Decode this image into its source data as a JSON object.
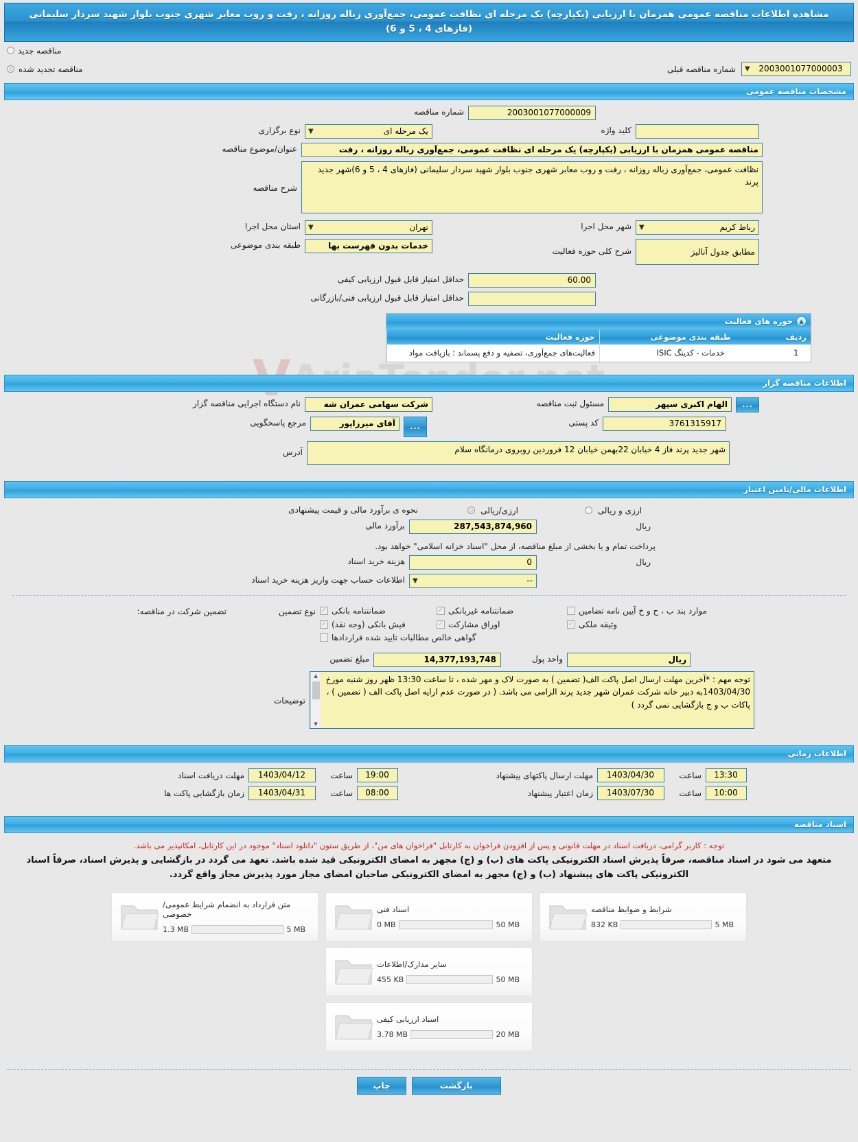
{
  "page": {
    "title": "مشاهده اطلاعات مناقصه عمومی همزمان با ارزیابی (یکپارچه) یک مرحله ای نظافت عمومی، جمع‌آوری زباله روزانه ، رفت و روب معابر شهری جنوب بلوار شهید سردار سلیمانی (فازهای 4 ، 5 و 6)"
  },
  "tender_type": {
    "new_label": "مناقصه جدید",
    "renewed_label": "مناقصه تجدید شده",
    "selected": "renewed",
    "previous_number_label": "شماره مناقصه قبلی",
    "previous_number_value": "2003001077000003"
  },
  "general": {
    "section_title": "مشخصات مناقصه عمومی",
    "tender_number_label": "شماره مناقصه",
    "tender_number_value": "2003001077000009",
    "holding_type_label": "نوع برگزاری",
    "holding_type_value": "یک مرحله ای",
    "keyword_label": "کلید واژه",
    "keyword_value": "",
    "subject_label": "عنوان/موضوع مناقصه",
    "subject_value": "مناقصه عمومی همزمان با ارزیابی (یکپارچه) یک مرحله ای نظافت عمومی، جمع‌آوری زباله روزانه ، رفت",
    "description_label": "شرح مناقصه",
    "description_value": "نظافت عمومی، جمع‌آوری زباله روزانه ، رفت و روب معابر شهری جنوب بلوار شهید سردار سلیمانی (فازهای 4 ، 5 و 6)شهر جدید پرند",
    "province_label": "استان محل اجرا",
    "province_value": "تهران",
    "city_label": "شهر محل اجرا",
    "city_value": "رباط کریم",
    "classification_label": "طبقه بندی موضوعی",
    "classification_value": "خدمات بدون فهرست بها",
    "activity_summary_label": "شرح کلی حوزه فعالیت",
    "activity_summary_value": "مطابق جدول آنالیز",
    "min_qualitative_label": "حداقل امتیاز قابل قبول ارزیابی کیفی",
    "min_qualitative_value": "60.00",
    "min_technical_label": "حداقل امتیاز قابل قبول ارزیابی فنی/بازرگانی",
    "min_technical_value": ""
  },
  "activity_areas": {
    "panel_title": "حوزه های فعالیت",
    "columns": [
      "ردیف",
      "طبقه بندی موضوعی",
      "حوزه فعالیت"
    ],
    "rows": [
      {
        "index": "1",
        "category": "خدمات - کدینگ ISIC",
        "area": "فعالیت‌های جمع‌آوری، تصفیه و دفع پسماند ؛ بازیافت مواد"
      }
    ]
  },
  "organizer": {
    "section_title": "اطلاعات مناقصه گزار",
    "agency_label": "نام دستگاه اجرایی مناقصه گزار",
    "agency_value": "شرکت سهامی عمران شه",
    "registrar_label": "مسئول ثبت مناقصه",
    "registrar_value": "الهام  اکبری سپهر",
    "contact_label": "مرجع پاسخگویی",
    "contact_value": "آقای میرزاپور",
    "postal_label": "کد پستی",
    "postal_value": "3761315917",
    "address_label": "آدرس",
    "address_value": "شهر جدید پرند فاز 4 خیابان 22بهمن خیابان 12 فروردین روبروی درمانگاه سلام",
    "more_button": "..."
  },
  "finance": {
    "section_title": "اطلاعات مالی/تامین اعتبار",
    "estimate_method_label": "نحوه ی برآورد مالی و قیمت پیشنهادی",
    "option_foreign_rial": "ارزی/ریالی",
    "option_foreign_and_rial": "ارزی و ریالی",
    "estimate_label": "برآورد مالی",
    "estimate_value": "287,543,874,960",
    "currency_unit": "ریال",
    "treasury_note": "پرداخت تمام و یا بخشی از مبلغ مناقصه، از محل \"اسناد خزانه اسلامی\" خواهد بود.",
    "doc_cost_label": "هزینه خرید اسناد",
    "doc_cost_value": "0",
    "account_info_label": "اطلاعات حساب جهت واریز هزینه خرید اسناد",
    "account_info_value": "--"
  },
  "guarantee": {
    "type_label": "نوع تضمین",
    "participation_label": "تضمین شرکت در مناقصه:",
    "options": [
      {
        "label": "ضمانتنامه بانکی",
        "checked": true
      },
      {
        "label": "ضمانتنامه غیربانکی",
        "checked": true
      },
      {
        "label": "موارد بند ب ، ح و خ آیین نامه تضامین",
        "checked": false
      },
      {
        "label": "فیش بانکی (وجه نقد)",
        "checked": true
      },
      {
        "label": "اوراق مشارکت",
        "checked": true
      },
      {
        "label": "وثیقه ملکی",
        "checked": true
      },
      {
        "label": "گواهی خالص مطالبات تایید شده قراردادها",
        "checked": false
      }
    ],
    "amount_label": "مبلغ تضمین",
    "amount_value": "14,377,193,748",
    "currency_label": "واحد پول",
    "currency_value": "ریال",
    "notes_label": "توضیحات",
    "notes_value": "توجه مهم :\n*آخرین مهلت ارسال اصل پاکت الف( تضمین ) به صورت لاک و مهر شده ، تا ساعت 13:30 ظهر روز شنبه مورخ 1403/04/30به دبیر خانه شرکت عمران شهر جدید پرند الزامی می باشد. ( در صورت عدم ارایه اصل پاکت الف ( تضمین ) ، پاکات ب و ج بازگشایی نمی گردد )"
  },
  "timing": {
    "section_title": "اطلاعات زمانی",
    "hour_label": "ساعت",
    "rows": [
      {
        "label": "مهلت دریافت اسناد",
        "date": "1403/04/12",
        "time": "19:00"
      },
      {
        "label": "مهلت ارسال پاکتهای پیشنهاد",
        "date": "1403/04/30",
        "time": "13:30"
      },
      {
        "label": "زمان بازگشایی پاکت ها",
        "date": "1403/04/31",
        "time": "08:00"
      },
      {
        "label": "زمان اعتبار پیشنهاد",
        "date": "1403/07/30",
        "time": "10:00"
      }
    ]
  },
  "documents": {
    "section_title": "اسناد مناقصه",
    "notice_red": "توجه : کاربر گرامی، دریافت اسناد در مهلت قانونی و پس از افزودن فراخوان به کارتابل \"فراخوان های من\"، از طریق ستون \"دانلود اسناد\" موجود در این کارتابل، امکانپذیر می باشد.",
    "notice_bold": "متعهد می شود در اسناد مناقصه، صرفاً پذیرش اسناد الکترونیکی پاکت های (ب) و (ج) مجهز به امضای الکترونیکی قید شده باشد. تعهد می گردد در بازگشایی و پذیرش اسناد، صرفاً اسناد الکترونیکی پاکت های پیشنهاد (ب) و (ج) مجهز به امضای الکترونیکی صاحبان امضای مجاز مورد پذیرش مجاز واقع گردد.",
    "files": [
      {
        "title": "شرایط و ضوابط مناقصه",
        "size": "832 KB",
        "limit": "5 MB",
        "percent": 16
      },
      {
        "title": "اسناد فنی",
        "size": "0 MB",
        "limit": "50 MB",
        "percent": 0
      },
      {
        "title": "متن قرارداد به انضمام شرایط عمومی/خصوصی",
        "size": "1.3 MB",
        "limit": "5 MB",
        "percent": 26
      },
      {
        "title": "سایر مدارک/اطلاعات",
        "size": "455 KB",
        "limit": "50 MB",
        "percent": 0
      },
      {
        "title": "اسناد ارزیابی کیفی",
        "size": "3.78 MB",
        "limit": "20 MB",
        "percent": 19
      }
    ]
  },
  "footer": {
    "print_label": "چاپ",
    "back_label": "بازگشت"
  },
  "watermark": {
    "text": "AriaTender.net"
  }
}
